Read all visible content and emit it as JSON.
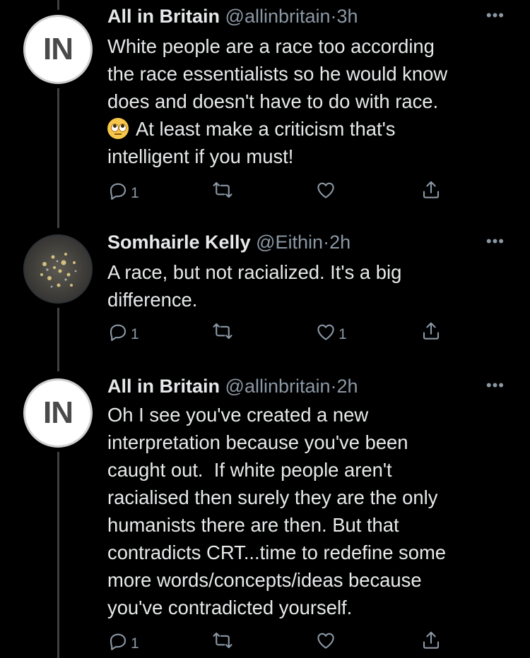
{
  "tweets": [
    {
      "avatar_text": "IN",
      "name": "All in Britain",
      "handle": "@allinbritain",
      "separator": "·",
      "time": "3h",
      "lines_before_emoji": "White people are a race too according\nthe race essentialists so he would know\ndoes and doesn't have to do with race.\n",
      "emoji": "face-with-rolling-eyes",
      "lines_after_emoji": "At least make a criticism that's\nintelligent if you must!",
      "reply_count": "1",
      "retweet_count": "",
      "like_count": ""
    },
    {
      "avatar_text": "",
      "name": "Somhairle Kelly",
      "handle": "@Eithin",
      "separator": "·",
      "time": "2h",
      "text": "A race, but not racialized. It's a big\ndifference.",
      "reply_count": "1",
      "retweet_count": "",
      "like_count": "1"
    },
    {
      "avatar_text": "IN",
      "name": "All in Britain",
      "handle": "@allinbritain",
      "separator": "·",
      "time": "2h",
      "text": "Oh I see you've created a new\ninterpretation because you've been\ncaught out.  If white people aren't\nracialised then surely they are the only\nhumanists there are then. But that\ncontradicts CRT...time to redefine some\nmore words/concepts/ideas because\nyou've contradicted yourself.",
      "reply_count": "1",
      "retweet_count": "",
      "like_count": ""
    }
  ],
  "more_icon": "ellipsis-icon",
  "colors": {
    "background": "#000000",
    "text": "#e7e9ea",
    "secondary": "#8b98a5",
    "thread_line": "#3e4144"
  }
}
